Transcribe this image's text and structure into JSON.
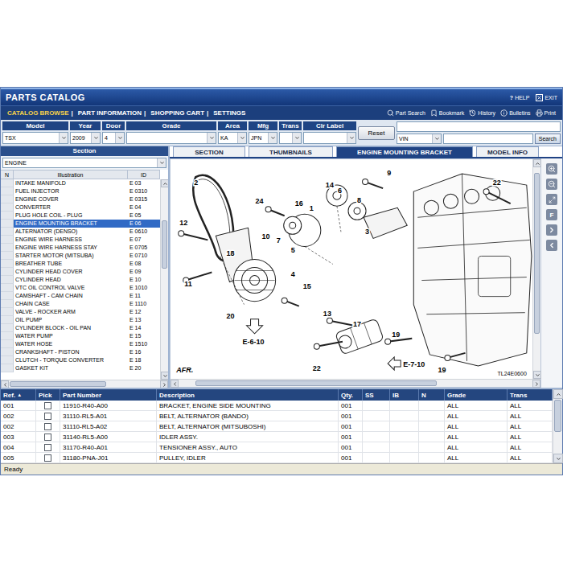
{
  "window": {
    "title": "PARTS CATALOG",
    "help": {
      "icon": "?",
      "label": "HELP"
    },
    "exit": {
      "label": "EXIT"
    }
  },
  "nav": {
    "items": [
      {
        "label": "CATALOG BROWSE",
        "separator": "|",
        "selected": true
      },
      {
        "label": "PART INFORMATION",
        "separator": "|",
        "selected": false
      },
      {
        "label": "SHOPPING CART",
        "separator": "|",
        "selected": false
      },
      {
        "label": "SETTINGS",
        "separator": "",
        "selected": false
      }
    ],
    "tools": [
      "Part Search",
      "Bookmark",
      "History",
      "Bulletins",
      "Print"
    ]
  },
  "filters": {
    "fields": [
      {
        "label": "Model",
        "value": "TSX"
      },
      {
        "label": "Year",
        "value": "2009"
      },
      {
        "label": "Door",
        "value": "4"
      },
      {
        "label": "Grade",
        "value": ""
      },
      {
        "label": "Area",
        "value": "KA"
      },
      {
        "label": "Mfg",
        "value": "JPN"
      },
      {
        "label": "Trans",
        "value": ""
      },
      {
        "label": "Clr Label",
        "value": ""
      }
    ],
    "reset": "Reset",
    "vin_input": "",
    "vin_select": "VIN",
    "search": "Search"
  },
  "section": {
    "header": "Section",
    "dropdown": "ENGINE",
    "columns": [
      "N",
      "Illustration",
      "ID"
    ],
    "items": [
      {
        "name": "INTAKE MANIFOLD",
        "id": "E 03",
        "selected": false
      },
      {
        "name": "FUEL INJECTOR",
        "id": "E 0310",
        "selected": false
      },
      {
        "name": "ENGINE COVER",
        "id": "E 0315",
        "selected": false
      },
      {
        "name": "CONVERTER",
        "id": "E 04",
        "selected": false
      },
      {
        "name": "PLUG HOLE COIL - PLUG",
        "id": "E 05",
        "selected": false
      },
      {
        "name": "ENGINE MOUNTING BRACKET",
        "id": "E 06",
        "selected": true
      },
      {
        "name": "ALTERNATOR (DENSO)",
        "id": "E 0610",
        "selected": false
      },
      {
        "name": "ENGINE WIRE HARNESS",
        "id": "E 07",
        "selected": false
      },
      {
        "name": "ENGINE WIRE HARNESS STAY",
        "id": "E 0705",
        "selected": false
      },
      {
        "name": "STARTER MOTOR (MITSUBA)",
        "id": "E 0710",
        "selected": false
      },
      {
        "name": "BREATHER TUBE",
        "id": "E 08",
        "selected": false
      },
      {
        "name": "CYLINDER HEAD COVER",
        "id": "E 09",
        "selected": false
      },
      {
        "name": "CYLINDER HEAD",
        "id": "E 10",
        "selected": false
      },
      {
        "name": "VTC OIL CONTROL VALVE",
        "id": "E 1010",
        "selected": false
      },
      {
        "name": "CAMSHAFT - CAM CHAIN",
        "id": "E 11",
        "selected": false
      },
      {
        "name": "CHAIN CASE",
        "id": "E 1110",
        "selected": false
      },
      {
        "name": "VALVE - ROCKER ARM",
        "id": "E 12",
        "selected": false
      },
      {
        "name": "OIL PUMP",
        "id": "E 13",
        "selected": false
      },
      {
        "name": "CYLINDER BLOCK - OIL PAN",
        "id": "E 14",
        "selected": false
      },
      {
        "name": "WATER PUMP",
        "id": "E 15",
        "selected": false
      },
      {
        "name": "WATER HOSE",
        "id": "E 1510",
        "selected": false
      },
      {
        "name": "CRANKSHAFT - PISTON",
        "id": "E 16",
        "selected": false
      },
      {
        "name": "CLUTCH - TORQUE CONVERTER",
        "id": "E 18",
        "selected": false
      },
      {
        "name": "GASKET KIT",
        "id": "E 20",
        "selected": false
      }
    ]
  },
  "tabs": [
    {
      "label": "SECTION",
      "selected": false
    },
    {
      "label": "THUMBNAILS",
      "selected": false
    },
    {
      "label": "ENGINE MOUNTING BRACKET",
      "selected": true
    },
    {
      "label": "MODEL INFO",
      "selected": false
    }
  ],
  "diagram": {
    "callouts": [
      "2",
      "14",
      "6",
      "9",
      "8",
      "22",
      "3",
      "24",
      "16",
      "1",
      "10",
      "7",
      "5",
      "4",
      "12",
      "18",
      "11",
      "15",
      "20",
      "13",
      "17",
      "19",
      "22",
      "19"
    ],
    "refs": [
      "E-6-10",
      "E-7-10"
    ],
    "orientation": "AFR.",
    "code": "TL24E0600"
  },
  "toolbar": {
    "text_button": "F"
  },
  "parts": {
    "columns": [
      {
        "label": "Ref.",
        "sort": "▲"
      },
      {
        "label": "Pick",
        "sort": ""
      },
      {
        "label": "Part Number",
        "sort": ""
      },
      {
        "label": "Description",
        "sort": ""
      },
      {
        "label": "Qty.",
        "sort": ""
      },
      {
        "label": "SS",
        "sort": ""
      },
      {
        "label": "IB",
        "sort": ""
      },
      {
        "label": "N",
        "sort": ""
      },
      {
        "label": "Grade",
        "sort": ""
      },
      {
        "label": "Trans",
        "sort": ""
      }
    ],
    "rows": [
      {
        "ref": "001",
        "checked": false,
        "part_number": "11910-R40-A00",
        "description": "BRACKET, ENGINE SIDE MOUNTING",
        "qty": "001",
        "ss": "",
        "ib": "",
        "n": "",
        "grade": "ALL",
        "trans": "ALL"
      },
      {
        "ref": "002",
        "checked": false,
        "part_number": "31110-RL5-A01",
        "description": "BELT, ALTERNATOR (BANDO)",
        "qty": "001",
        "ss": "",
        "ib": "",
        "n": "",
        "grade": "ALL",
        "trans": "ALL"
      },
      {
        "ref": "002",
        "checked": false,
        "part_number": "31110-RL5-A02",
        "description": "BELT, ALTERNATOR (MITSUBOSHI)",
        "qty": "001",
        "ss": "",
        "ib": "",
        "n": "",
        "grade": "ALL",
        "trans": "ALL"
      },
      {
        "ref": "003",
        "checked": false,
        "part_number": "31140-RL5-A00",
        "description": "IDLER ASSY.",
        "qty": "001",
        "ss": "",
        "ib": "",
        "n": "",
        "grade": "ALL",
        "trans": "ALL"
      },
      {
        "ref": "004",
        "checked": false,
        "part_number": "31170-R40-A01",
        "description": "TENSIONER ASSY., AUTO",
        "qty": "001",
        "ss": "",
        "ib": "",
        "n": "",
        "grade": "ALL",
        "trans": "ALL"
      },
      {
        "ref": "005",
        "checked": false,
        "part_number": "31180-PNA-J01",
        "description": "PULLEY, IDLER",
        "qty": "001",
        "ss": "",
        "ib": "",
        "n": "",
        "grade": "ALL",
        "trans": "ALL"
      }
    ]
  },
  "status_bar": "Ready"
}
